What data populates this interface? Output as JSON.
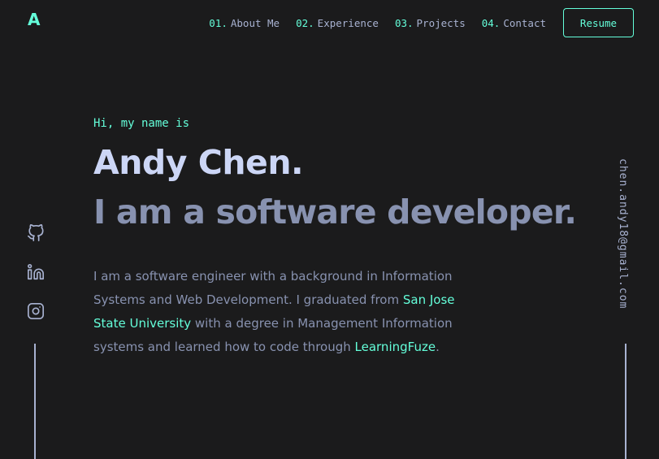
{
  "brand": {
    "logo": "A",
    "accent": "#64ffda",
    "background": "#1b1b1c"
  },
  "nav": {
    "items": [
      {
        "num": "01.",
        "label": "About Me"
      },
      {
        "num": "02.",
        "label": "Experience"
      },
      {
        "num": "03.",
        "label": "Projects"
      },
      {
        "num": "04.",
        "label": "Contact"
      }
    ],
    "resume_label": "Resume"
  },
  "hero": {
    "greeting": "Hi, my name is",
    "name": "Andy Chen.",
    "tagline": "I am a software developer.",
    "bio": {
      "part1": "I am a software engineer with a background in Information Systems and Web Development. I graduated from ",
      "link1": "San Jose State University",
      "part2": " with a degree in Management Information systems and learned how to code through ",
      "link2": "LearningFuze",
      "part3": "."
    }
  },
  "social": {
    "icons": [
      "github-icon",
      "linkedin-icon",
      "instagram-icon"
    ]
  },
  "email": "chen.andy18@gmail.com"
}
